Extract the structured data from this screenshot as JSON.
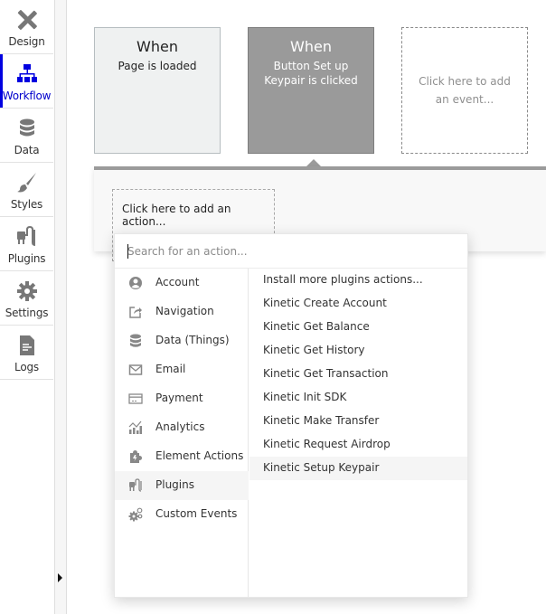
{
  "sidebar": {
    "items": [
      {
        "label": "Design",
        "icon": "design-icon",
        "active": false
      },
      {
        "label": "Workflow",
        "icon": "workflow-icon",
        "active": true
      },
      {
        "label": "Data",
        "icon": "database-icon",
        "active": false
      },
      {
        "label": "Styles",
        "icon": "brush-icon",
        "active": false
      },
      {
        "label": "Plugins",
        "icon": "plug-icon",
        "active": false
      },
      {
        "label": "Settings",
        "icon": "gear-icon",
        "active": false
      },
      {
        "label": "Logs",
        "icon": "document-icon",
        "active": false
      }
    ],
    "accent_color": "#0000e0"
  },
  "rail": {
    "expand_icon": "triangle-right-icon"
  },
  "events": [
    {
      "when": "When",
      "description": "Page is loaded"
    },
    {
      "when": "When",
      "description": "Button Set up Keypair is clicked",
      "selected": true
    },
    {
      "placeholder": "Click here to add an event..."
    }
  ],
  "action_panel": {
    "add_action_label": "Click here to add an action..."
  },
  "action_picker": {
    "search_placeholder": "Search for an action...",
    "search_value": "",
    "categories": [
      {
        "label": "Account",
        "icon": "user-circle-icon"
      },
      {
        "label": "Navigation",
        "icon": "share-icon"
      },
      {
        "label": "Data (Things)",
        "icon": "database-icon"
      },
      {
        "label": "Email",
        "icon": "envelope-icon"
      },
      {
        "label": "Payment",
        "icon": "credit-card-icon"
      },
      {
        "label": "Analytics",
        "icon": "chart-icon"
      },
      {
        "label": "Element Actions",
        "icon": "puzzle-icon"
      },
      {
        "label": "Plugins",
        "icon": "plug-icon",
        "selected": true
      },
      {
        "label": "Custom Events",
        "icon": "gears-icon"
      }
    ],
    "actions": [
      {
        "label": "Install more plugins actions..."
      },
      {
        "label": "Kinetic Create Account"
      },
      {
        "label": "Kinetic Get Balance"
      },
      {
        "label": "Kinetic Get History"
      },
      {
        "label": "Kinetic Get Transaction"
      },
      {
        "label": "Kinetic Init SDK"
      },
      {
        "label": "Kinetic Make Transfer"
      },
      {
        "label": "Kinetic Request Airdrop"
      },
      {
        "label": "Kinetic Setup Keypair",
        "hovered": true
      }
    ]
  }
}
